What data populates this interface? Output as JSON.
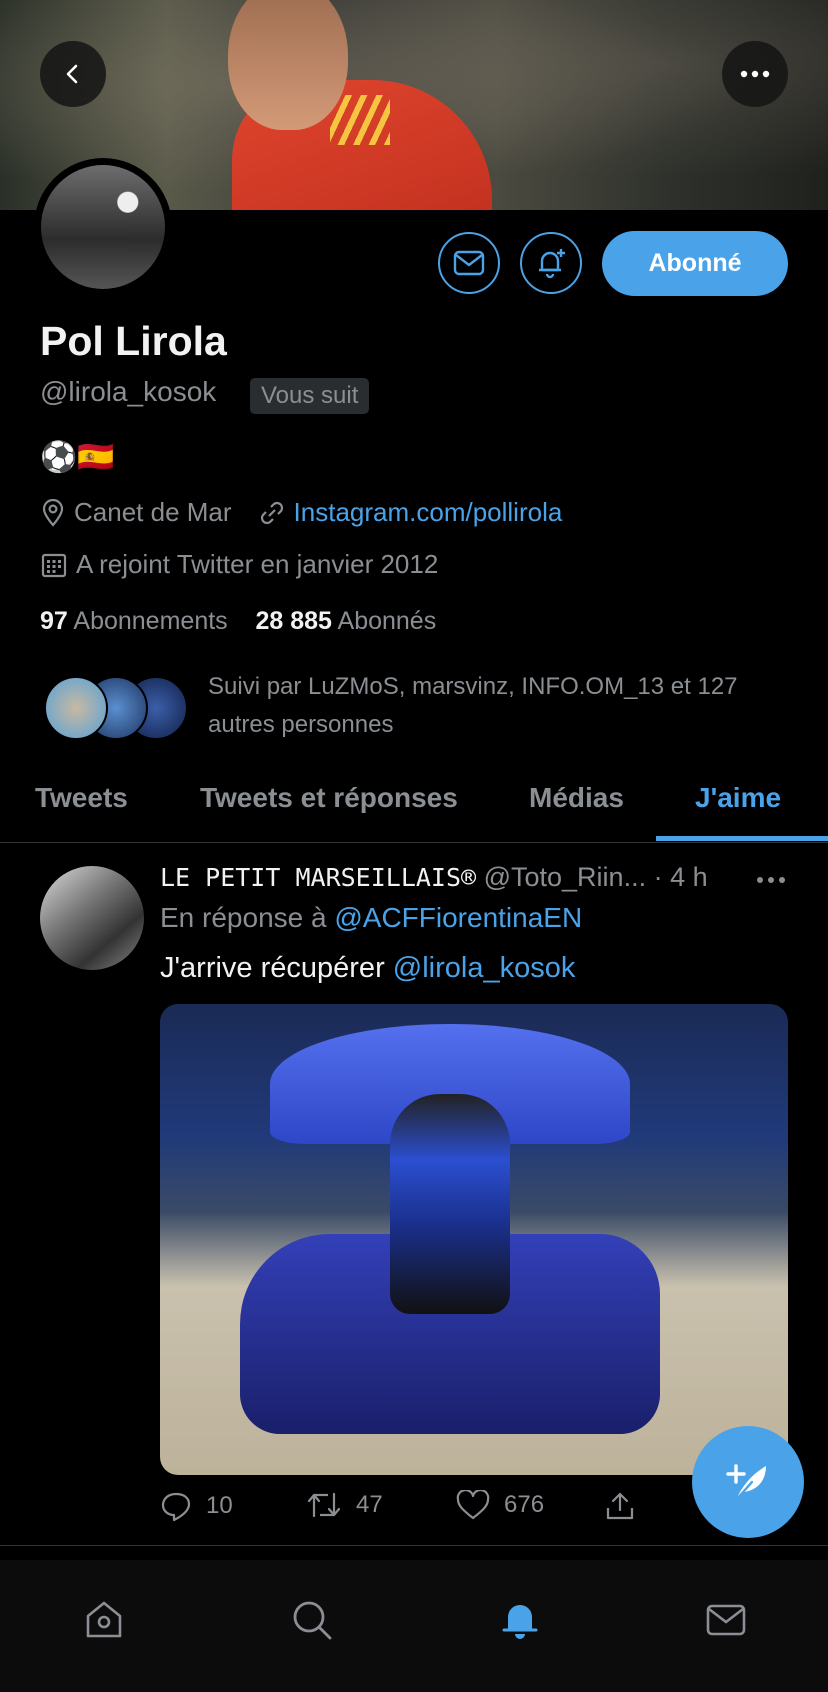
{
  "header": {
    "back_icon": "chevron-left-icon",
    "more_icon": "more-horizontal-icon"
  },
  "profile": {
    "name": "Pol Lirola",
    "handle": "@lirola_kosok",
    "follows_you": "Vous suit",
    "bio": "⚽️🇪🇸",
    "location": "Canet de Mar",
    "website": "Instagram.com/pollirola",
    "joined": "A rejoint Twitter en janvier 2012",
    "following_count": "97",
    "following_label": "Abonnements",
    "followers_count": "28 885",
    "followers_label": "Abonnés",
    "followed_by": "Suivi par LuZMoS, marsvinz, INFO.OM_13 et 127 autres personnes",
    "follow_button": "Abonné"
  },
  "tabs": [
    "Tweets",
    "Tweets et réponses",
    "Médias",
    "J'aime"
  ],
  "active_tab": "J'aime",
  "tweet": {
    "author": "LE PETIT MARSEILLAIS®",
    "handle": "@Toto_Riin...",
    "time": "· 4 h",
    "reply_prefix": "En réponse à",
    "reply_to": "@ACFFiorentinaEN",
    "text_prefix": "J'arrive récupérer",
    "text_mention": "@lirola_kosok",
    "replies": "10",
    "retweets": "47",
    "likes": "676"
  },
  "colors": {
    "accent": "#4aa3e8",
    "background": "#000000",
    "secondary_text": "#8b8f93"
  },
  "bottom_nav": [
    "home-icon",
    "search-icon",
    "notifications-icon",
    "messages-icon"
  ]
}
